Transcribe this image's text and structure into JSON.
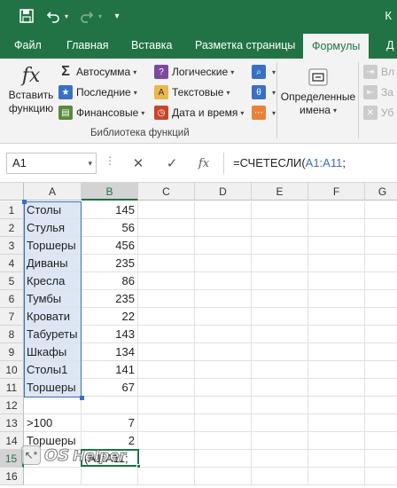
{
  "titlebar": {
    "title": "К",
    "customize_icon": "▾"
  },
  "tabs": [
    {
      "label": "Файл"
    },
    {
      "label": "Главная"
    },
    {
      "label": "Вставка"
    },
    {
      "label": "Разметка страницы"
    },
    {
      "label": "Формулы",
      "active": true
    },
    {
      "label": "Д"
    }
  ],
  "ribbon": {
    "insert_function": {
      "line1": "Вставить",
      "line2": "функцию",
      "icon": "fx"
    },
    "autosum": "Автосумма",
    "recent": "Последние",
    "financial": "Финансовые",
    "logical": "Логические",
    "text": "Текстовые",
    "datetime": "Дата и время",
    "group_label": "Библиотека функций",
    "defined_names": {
      "line1": "Определенные",
      "line2": "имена"
    },
    "trace_precedents": "Вл",
    "trace_dependents": "За",
    "remove_arrows": "Уб"
  },
  "formula_bar": {
    "name_box": "A1",
    "dots": "⋮",
    "cancel": "✕",
    "enter": "✓",
    "fx": "fx",
    "formula_prefix": "=СЧЕТЕСЛИ(",
    "formula_ref": "A1:A11",
    "formula_suffix": ";"
  },
  "columns": [
    "A",
    "B",
    "C",
    "D",
    "E",
    "F",
    "G"
  ],
  "rows": [
    {
      "n": "1",
      "a": "Столы",
      "b": "145"
    },
    {
      "n": "2",
      "a": "Стулья",
      "b": "56"
    },
    {
      "n": "3",
      "a": "Торшеры",
      "b": "456"
    },
    {
      "n": "4",
      "a": "Диваны",
      "b": "235"
    },
    {
      "n": "5",
      "a": "Кресла",
      "b": "86"
    },
    {
      "n": "6",
      "a": "Тумбы",
      "b": "235"
    },
    {
      "n": "7",
      "a": "Кровати",
      "b": "22"
    },
    {
      "n": "8",
      "a": "Табуреты",
      "b": "143"
    },
    {
      "n": "9",
      "a": "Шкафы",
      "b": "134"
    },
    {
      "n": "10",
      "a": "Столы1",
      "b": "141"
    },
    {
      "n": "11",
      "a": "Торшеры",
      "b": "67"
    },
    {
      "n": "12",
      "a": "",
      "b": ""
    },
    {
      "n": "13",
      "a": ">100",
      "b": "7"
    },
    {
      "n": "14",
      "a": "Торшеры",
      "b": "2"
    },
    {
      "n": "15",
      "a": "",
      "b": "(A1:A11;"
    },
    {
      "n": "16",
      "a": "",
      "b": ""
    }
  ],
  "watermark": {
    "os": "OS",
    "helper": "Helper",
    "logo": "↖*"
  },
  "colors": {
    "excel_green": "#217346",
    "ref_blue": "#3a6fc4",
    "range_fill": "#dce6f4"
  }
}
